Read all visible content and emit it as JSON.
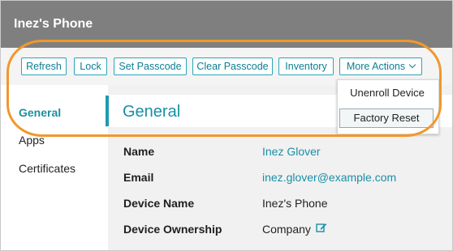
{
  "header": {
    "title": "Inez's Phone"
  },
  "toolbar": {
    "buttons": [
      "Refresh",
      "Lock",
      "Set Passcode",
      "Clear Passcode",
      "Inventory"
    ],
    "more_actions": "More Actions"
  },
  "dropdown": {
    "items": [
      "Unenroll Device",
      "Factory Reset"
    ]
  },
  "sidebar": {
    "items": [
      "General",
      "Apps",
      "Certificates"
    ]
  },
  "section": {
    "title": "General"
  },
  "fields": [
    {
      "label": "Name",
      "value": "Inez Glover"
    },
    {
      "label": "Email",
      "value": "inez.glover@example.com"
    },
    {
      "label": "Device Name",
      "value": "Inez's Phone"
    },
    {
      "label": "Device Ownership",
      "value": "Company"
    }
  ],
  "colors": {
    "accent": "#1d9ab0",
    "highlight_ring": "#f1982c",
    "header": "#7f7f7f"
  },
  "icons": {
    "ownership_edit": "edit-icon",
    "more_actions_chevron": "chevron-down-icon"
  }
}
